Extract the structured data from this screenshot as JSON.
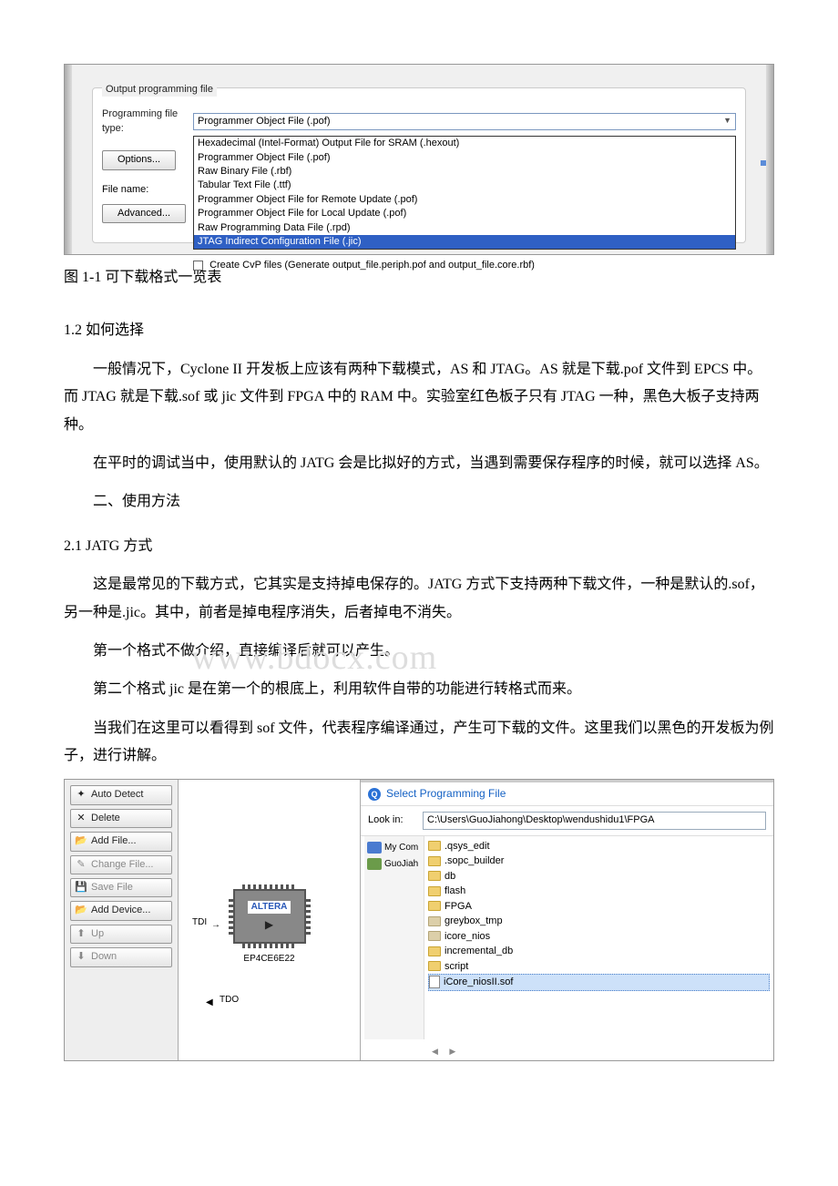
{
  "screenshot1": {
    "groupbox_label": "Output programming file",
    "row1_label": "Programming file type:",
    "dropdown_selected": "Programmer Object File (.pof)",
    "options_items": [
      "Hexadecimal (Intel-Format) Output File for SRAM (.hexout)",
      "Programmer Object File (.pof)",
      "Raw Binary File (.rbf)",
      "Tabular Text File (.ttf)",
      "Programmer Object File for Remote Update (.pof)",
      "Programmer Object File for Local Update (.pof)",
      "Raw Programming Data File (.rpd)",
      "JTAG Indirect Configuration File (.jic)"
    ],
    "selected_index": 7,
    "btn_options": "Options...",
    "row_file_label": "File name:",
    "btn_advanced": "Advanced...",
    "checkbox_label": "Create CvP files (Generate output_file.periph.pof and output_file.core.rbf)"
  },
  "caption_fig11": "图 1-1 可下载格式一览表",
  "watermark": "www.bdocx.com",
  "text": {
    "h12": "1.2 如何选择",
    "p1": "一般情况下，Cyclone II 开发板上应该有两种下载模式，AS 和 JTAG。AS 就是下载.pof 文件到 EPCS 中。而 JTAG 就是下载.sof 或 jic 文件到 FPGA 中的 RAM 中。实验室红色板子只有 JTAG 一种，黑色大板子支持两种。",
    "p2": "在平时的调试当中，使用默认的 JATG 会是比拟好的方式，当遇到需要保存程序的时候，就可以选择 AS。",
    "h2": "二、使用方法",
    "h21": "2.1 JATG 方式",
    "p3": "这是最常见的下载方式，它其实是支持掉电保存的。JATG 方式下支持两种下载文件，一种是默认的.sof，另一种是.jic。其中，前者是掉电程序消失，后者掉电不消失。",
    "p4": "第一个格式不做介绍，直接编译后就可以产生。",
    "p5": "第二个格式 jic 是在第一个的根底上，利用软件自带的功能进行转格式而来。",
    "p6": "当我们在这里可以看得到 sof 文件，代表程序编译通过，产生可下载的文件。这里我们以黑色的开发板为例子，进行讲解。"
  },
  "screenshot2": {
    "buttons": {
      "auto_detect": "Auto Detect",
      "delete": "Delete",
      "add_file": "Add File...",
      "change_file": "Change File...",
      "save_file": "Save File",
      "add_device": "Add Device...",
      "up": "Up",
      "down": "Down"
    },
    "tdi": "TDI",
    "tdo": "TDO",
    "chip_logo": "ALTERA",
    "chip_model": "EP4CE6E22",
    "dialog_title": "Select Programming File",
    "lookin_label": "Look in:",
    "lookin_path": "C:\\Users\\GuoJiahong\\Desktop\\wendushidu1\\FPGA",
    "places": [
      "My Com",
      "GuoJiah"
    ],
    "files": [
      ".qsys_edit",
      ".sopc_builder",
      "db",
      "flash",
      "FPGA",
      "greybox_tmp",
      "icore_nios",
      "incremental_db",
      "script"
    ],
    "selected_file": "iCore_niosII.sof"
  }
}
